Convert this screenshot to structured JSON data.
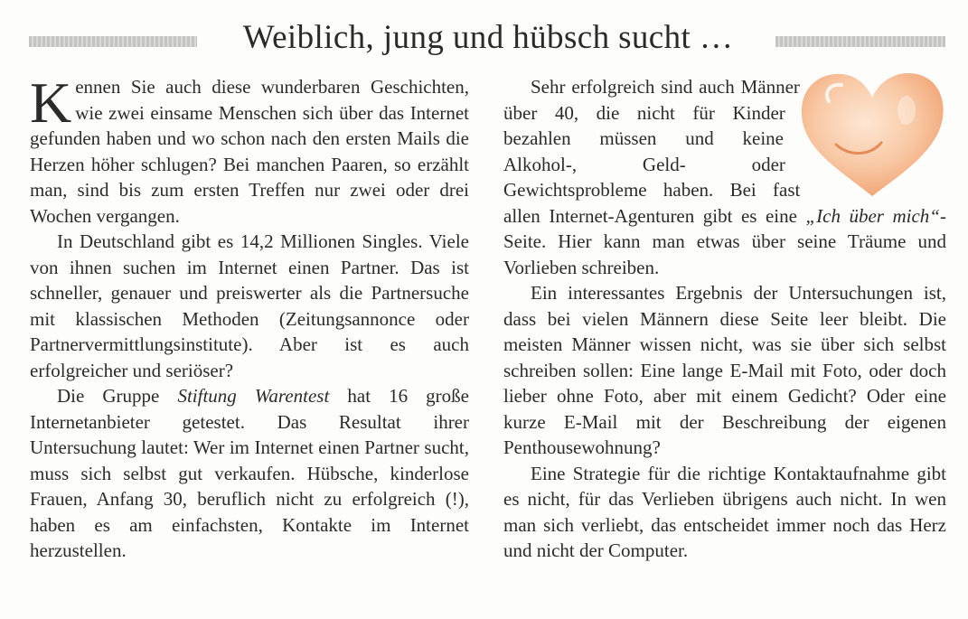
{
  "article": {
    "title": "Weiblich, jung und hübsch sucht …",
    "left_column": {
      "dropcap": "K",
      "p1_rest": "ennen Sie auch diese wunderbaren Geschichten, wie zwei einsame Menschen sich über das Internet gefunden haben und wo schon nach den ersten Mails die Herzen höher schlugen? Bei manchen Paaren, so erzählt man, sind bis zum ersten Treffen nur zwei oder drei Wochen vergangen.",
      "p2": "In Deutschland gibt es 14,2 Millionen Singles. Viele von ihnen suchen im Internet einen Partner. Das ist schneller, genauer und preiswerter als die Partnersuche mit klassischen Methoden (Zeitungsannonce oder Partnervermittlungsinstitute). Aber ist es auch erfolgreicher und seriöser?",
      "p3_a": "Die Gruppe ",
      "p3_em": "Stiftung Warentest",
      "p3_b": " hat 16 große Internetanbieter getestet. Das Resultat ihrer Untersuchung lautet: Wer im Internet einen Partner sucht, muss sich selbst gut verkaufen. Hübsche, kinderlose Frauen, Anfang 30, beruflich nicht zu erfolgreich (!), haben es am einfachsten, Kontakte im Internet herzustellen."
    },
    "right_column": {
      "p1_a": "Sehr erfolgreich sind auch Männer über 40, die nicht für Kinder bezahlen müssen und keine Alkohol-, Geld- oder Gewichtsprobleme haben. Bei fast allen Internet-Agenturen gibt es eine ",
      "p1_em": "„Ich über mich“",
      "p1_b": "-Seite. Hier kann man etwas über seine Träume und Vorlieben schreiben.",
      "p2": "Ein interessantes Ergebnis der Untersuchungen ist, dass bei vielen Männern diese Seite leer bleibt. Die meisten Männer wissen nicht, was sie über sich selbst schreiben sollen: Eine lange E-Mail mit Foto, oder doch lieber ohne Foto, aber mit einem Gedicht? Oder eine kurze E-Mail mit der Beschreibung der eigenen Penthousewohnung?",
      "p3": "Eine Strategie für die richtige Kontaktaufnahme gibt es nicht, für das Verlieben übrigens auch nicht. In wen man sich verliebt, das entscheidet immer noch das Herz und nicht der Computer."
    },
    "colors": {
      "text": "#2b2b2b",
      "heart": "#f4b48a"
    },
    "icons": [
      "heart-illustration"
    ]
  }
}
